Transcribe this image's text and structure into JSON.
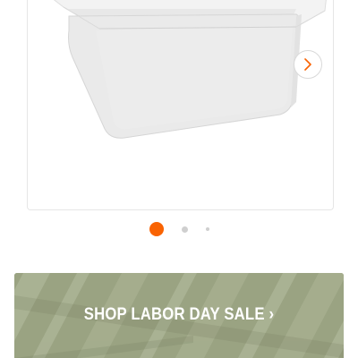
{
  "carousel": {
    "image_alt": "white utility sink tub",
    "next_icon": "chevron-right-icon",
    "dots": [
      {
        "state": "active",
        "color": "#f96302"
      },
      {
        "state": "inactive",
        "color": "#cfcfcf"
      },
      {
        "state": "inactive",
        "color": "#cfcfcf"
      }
    ]
  },
  "promo_banner": {
    "label": "SHOP LABOR DAY SALE ›",
    "text_color": "#ffffff",
    "background_color": "#9aa382"
  }
}
